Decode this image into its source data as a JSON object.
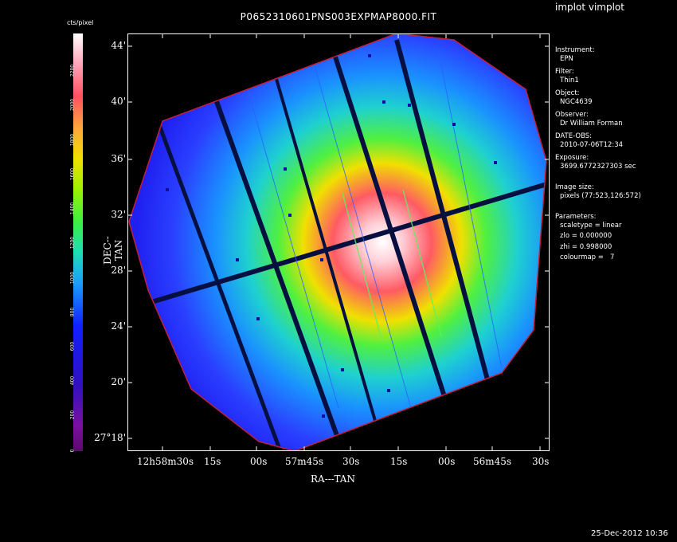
{
  "app_title": "implot vimplot",
  "plot_title": "P0652310601PNS003EXPMAP8000.FIT",
  "colorbar": {
    "label": "cts/pixel",
    "ticks": [
      "0",
      "200",
      "400",
      "600",
      "800",
      "1000",
      "1200",
      "1400",
      "1600",
      "1800",
      "2000",
      "2200"
    ]
  },
  "axes": {
    "ylabel": "DEC--TAN",
    "xlabel": "RA---TAN",
    "yticks": [
      "44'",
      "40'",
      "36'",
      "32'",
      "28'",
      "24'",
      "20'",
      "27°18'"
    ],
    "xticks": [
      "12h58m30s",
      "15s",
      "00s",
      "57m45s",
      "30s",
      "15s",
      "00s",
      "56m45s",
      "30s"
    ]
  },
  "info": {
    "instrument_label": "Instrument:",
    "instrument": "EPN",
    "filter_label": "Filter:",
    "filter": "Thin1",
    "object_label": "Object:",
    "object": "NGC4639",
    "observer_label": "Observer:",
    "observer": "Dr William Forman",
    "date_label": "DATE-OBS:",
    "date": "2010-07-06T12:34",
    "exposure_label": "Exposure:",
    "exposure": "3699.6772327303 sec",
    "imagesize_label": "Image size:",
    "imagesize": "pixels (77:523,126:572)",
    "params_label": "Parameters:",
    "p1": "scaletype = linear",
    "p2": "zlo = 0.000000",
    "p3": "zhi = 0.998000",
    "p4": "colourmap =   7"
  },
  "timestamp": "25-Dec-2012 10:36"
}
